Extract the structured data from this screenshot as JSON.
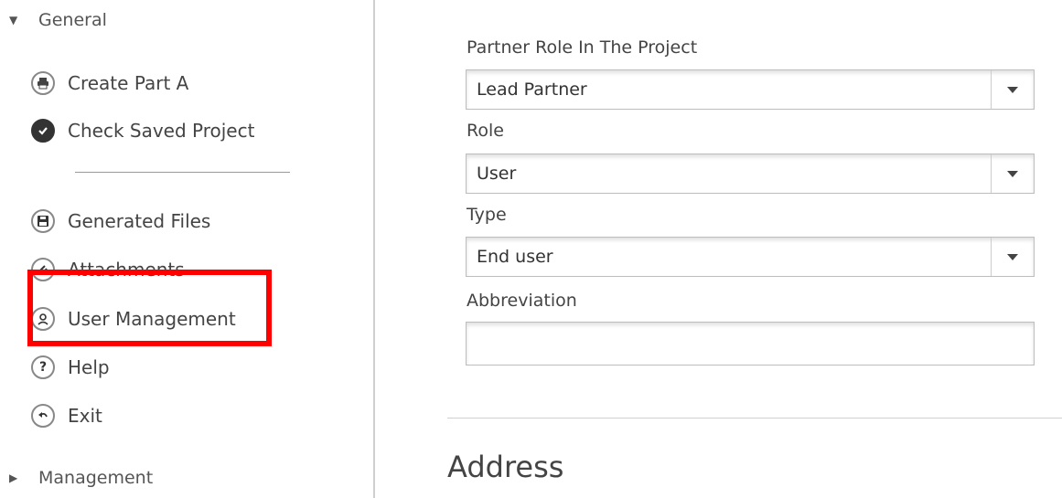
{
  "sidebar": {
    "general_label": "General",
    "management_label": "Management",
    "items": [
      {
        "label": "Create Part A",
        "icon": "printer-icon"
      },
      {
        "label": "Check Saved Project",
        "icon": "check-circle-icon"
      },
      {
        "label": "Generated Files",
        "icon": "save-icon"
      },
      {
        "label": "Attachments",
        "icon": "paperclip-icon"
      },
      {
        "label": "User Management",
        "icon": "user-icon"
      },
      {
        "label": "Help",
        "icon": "question-icon"
      },
      {
        "label": "Exit",
        "icon": "undo-icon"
      }
    ]
  },
  "form": {
    "partner_role": {
      "label": "Partner Role In The Project",
      "value": "Lead Partner"
    },
    "role": {
      "label": "Role",
      "value": "User"
    },
    "type": {
      "label": "Type",
      "value": "End user"
    },
    "abbreviation": {
      "label": "Abbreviation",
      "value": ""
    }
  },
  "address_heading": "Address",
  "colors": {
    "highlight": "#ff0000",
    "text": "#444444",
    "border": "#bdbdbd"
  }
}
